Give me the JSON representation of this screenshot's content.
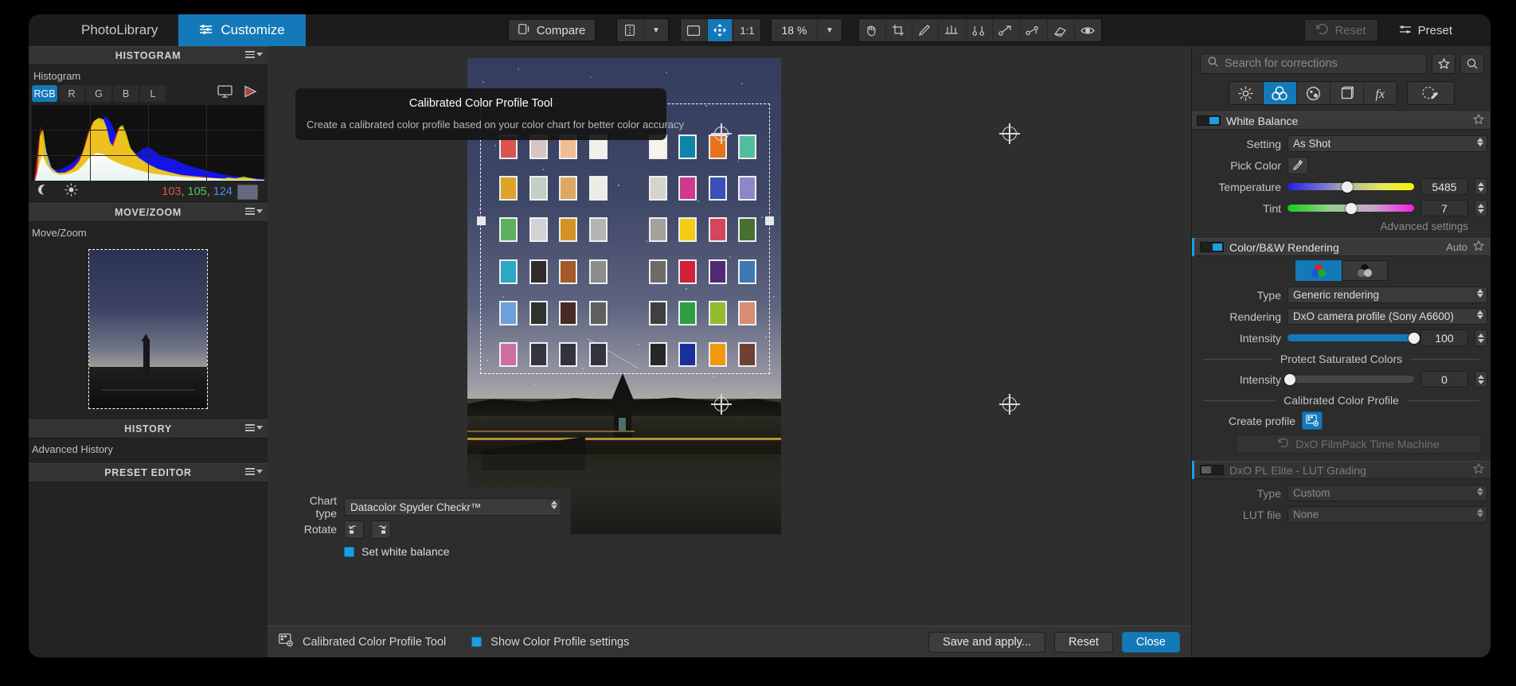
{
  "app": {
    "name": "DxO PhotoLab"
  },
  "topbar": {
    "tabs": [
      {
        "label": "PhotoLibrary",
        "icon": "library-icon",
        "active": false
      },
      {
        "label": "Customize",
        "icon": "sliders-icon",
        "active": true
      }
    ],
    "compare_label": "Compare",
    "compare_icon": "compare-icon",
    "view_mode_icon": "view-list-icon",
    "dropdown_caret": "▼",
    "fit_icon": "fit-screen-icon",
    "pan_icon": "pan-move-icon",
    "one_to_one": "1:1",
    "zoom_value": "18 %",
    "zoom_caret": "▼",
    "tools": [
      "hand-tool-icon",
      "crop-tool-icon",
      "retouch-tool-icon",
      "horizon-tool-icon",
      "control-line-icon",
      "control-point-icon",
      "graduated-filter-icon",
      "eraser-tool-icon",
      "red-eye-icon"
    ],
    "reset_label": "Reset",
    "reset_icon": "undo-icon",
    "preset_label": "Preset",
    "preset_icon": "sliders-icon"
  },
  "left_panel": {
    "histogram": {
      "section_title": "HISTOGRAM",
      "sub_label": "Histogram",
      "channels": [
        "RGB",
        "R",
        "G",
        "B",
        "L"
      ],
      "active_channel": "RGB",
      "monitor_icon": "monitor-icon",
      "gamut_icon": "gamut-warning-icon",
      "shadow_icon": "shadow-clip-icon",
      "highlight_icon": "highlight-clip-icon",
      "readout": {
        "r": "103",
        "g": "105",
        "b": "124",
        "separator": ","
      }
    },
    "move_zoom": {
      "section_title": "MOVE/ZOOM",
      "sub_label": "Move/Zoom"
    },
    "history": {
      "section_title": "HISTORY",
      "sub_label": "Advanced History"
    },
    "preset_editor": {
      "section_title": "PRESET EDITOR"
    }
  },
  "right_panel": {
    "search": {
      "placeholder": "Search for corrections",
      "icon": "search-icon"
    },
    "favorites_icon": "star-icon",
    "extra_icon": "search-circle-icon",
    "category_pills": [
      {
        "icon": "light-icon",
        "active": false
      },
      {
        "icon": "color-icon",
        "active": true
      },
      {
        "icon": "detail-icon",
        "active": false
      },
      {
        "icon": "geometry-icon",
        "active": false
      },
      {
        "icon": "effects-icon",
        "active": false
      }
    ],
    "local_adjust_icon": "local-adjustments-icon",
    "white_balance": {
      "title": "White Balance",
      "enabled": true,
      "star_icon": "star-outline-icon",
      "setting_label": "Setting",
      "setting_value": "As Shot",
      "pick_color_label": "Pick Color",
      "eyedropper_icon": "eyedropper-icon",
      "temperature_label": "Temperature",
      "temperature_value": "5485",
      "temperature_pct": 47,
      "tint_label": "Tint",
      "tint_value": "7",
      "tint_pct": 50,
      "advanced_label": "Advanced settings"
    },
    "color_bw": {
      "title": "Color/B&W Rendering",
      "auto_label": "Auto",
      "star_icon": "star-outline-icon",
      "mode_color_icon": "color-mode-icon",
      "mode_bw_icon": "bw-mode-icon",
      "mode_active": "color",
      "type_label": "Type",
      "type_value": "Generic rendering",
      "rendering_label": "Rendering",
      "rendering_value": "DxO camera profile (Sony A6600)",
      "intensity_label": "Intensity",
      "intensity_value": "100",
      "intensity_pct": 100,
      "protect_divider": "Protect Saturated Colors",
      "protect_intensity_label": "Intensity",
      "protect_intensity_value": "0",
      "protect_intensity_pct": 0,
      "calibrated_divider": "Calibrated Color Profile",
      "create_profile_label": "Create profile",
      "create_profile_icon": "color-chart-icon",
      "filmpack_label": "DxO FilmPack Time Machine",
      "filmpack_icon": "time-machine-icon"
    },
    "lut_grading": {
      "title": "DxO PL Elite - LUT Grading",
      "enabled": false,
      "star_icon": "star-outline-icon",
      "type_label": "Type",
      "type_value": "Custom",
      "lut_file_label": "LUT file",
      "lut_file_value": "None"
    }
  },
  "center": {
    "tooltip": {
      "title": "Calibrated Color Profile Tool",
      "body": "Create a calibrated color profile based on your color chart for better color accuracy"
    },
    "chart_panel": {
      "chart_type_label": "Chart type",
      "chart_type_value": "Datacolor Spyder Checkr™",
      "rotate_label": "Rotate",
      "rotate_ccw_icon": "rotate-left-icon",
      "rotate_cw_icon": "rotate-right-icon",
      "set_white_balance_label": "Set white balance",
      "set_white_balance_checked": true
    },
    "bottom_bar": {
      "tool_icon": "color-chart-icon",
      "tool_label": "Calibrated Color Profile Tool",
      "show_settings_label": "Show Color Profile settings",
      "show_settings_checked": true,
      "save_label": "Save and apply...",
      "reset_label": "Reset",
      "close_label": "Close"
    },
    "crop_handle_icon": "crosshair-handle-icon"
  },
  "colors": {
    "accent": "#1479b8",
    "panel": "#2c2c2c",
    "panel_dark": "#232323",
    "text": "#d9d9d9"
  },
  "color_chart": {
    "rows": 6,
    "cols": 8,
    "patches": [
      [
        "#d9544e",
        "#d8c5c1",
        "#f2bd93",
        "#f3efe9",
        null,
        "#f7f3ea",
        "#1083aa",
        "#e8711c",
        "#4fbe9e"
      ],
      [
        "#e0a329",
        "#c5cec2",
        "#dda862",
        "#ecece4",
        null,
        "#d7d4cb",
        "#cf3a8e",
        "#3c4fb6",
        "#8e86c9"
      ],
      [
        "#5fb05e",
        "#d4d2d6",
        "#d39327",
        "#b5b5b2",
        null,
        "#a5a19c",
        "#f2cc16",
        "#d5465c",
        "#4a7030"
      ],
      [
        "#2ba9c3",
        "#332b29",
        "#a35a26",
        "#8a8d8a",
        null,
        "#6d6b65",
        "#d0203a",
        "#4e2a72",
        "#3f79b4"
      ],
      [
        "#6d9fd8",
        "#2e3330",
        "#4a2a22",
        "#5c5f5b",
        null,
        "#3f3f3d",
        "#2f9d42",
        "#93bb2c",
        "#da8b73"
      ],
      [
        "#cc6f9e",
        "#34353f",
        "#32333c",
        "#343440",
        null,
        "#272727",
        "#1a2f9e",
        "#f0990d",
        "#6c4132"
      ]
    ]
  },
  "chart_data": {
    "type": "area",
    "title": "Histogram",
    "channels": [
      "RGB",
      "R",
      "G",
      "B",
      "L"
    ],
    "active_channel": "RGB",
    "xlabel": "",
    "ylabel": "",
    "readout_rgb": [
      103,
      105,
      124
    ],
    "series": [
      {
        "name": "R",
        "color": "#ff2222",
        "values": [
          4,
          52,
          92,
          44,
          16,
          12,
          11,
          12,
          14,
          16,
          19,
          24,
          36,
          58,
          78,
          84,
          80,
          62,
          44,
          58,
          70,
          60,
          40,
          26,
          20,
          17,
          15,
          14,
          13,
          12,
          11,
          10,
          10,
          9,
          9,
          8,
          8,
          7,
          7,
          6,
          6,
          5,
          5,
          4,
          4,
          4,
          3,
          3,
          3,
          2,
          2,
          2,
          2,
          2,
          2,
          2,
          2,
          2,
          3,
          4,
          3,
          2,
          2,
          1
        ]
      },
      {
        "name": "G",
        "color": "#22ff22",
        "values": [
          3,
          46,
          88,
          42,
          15,
          12,
          11,
          12,
          14,
          17,
          20,
          26,
          38,
          60,
          82,
          88,
          84,
          66,
          46,
          60,
          72,
          62,
          42,
          27,
          21,
          18,
          16,
          15,
          14,
          13,
          12,
          11,
          10,
          10,
          9,
          9,
          8,
          8,
          7,
          7,
          6,
          6,
          5,
          5,
          4,
          4,
          4,
          3,
          3,
          3,
          2,
          2,
          2,
          2,
          2,
          2,
          2,
          2,
          3,
          4,
          3,
          2,
          2,
          1
        ]
      },
      {
        "name": "B",
        "color": "#2222ff",
        "values": [
          2,
          30,
          58,
          34,
          14,
          12,
          12,
          13,
          15,
          18,
          22,
          26,
          30,
          34,
          40,
          46,
          54,
          66,
          82,
          96,
          90,
          70,
          52,
          42,
          38,
          40,
          44,
          40,
          34,
          30,
          28,
          30,
          34,
          30,
          26,
          24,
          22,
          20,
          19,
          18,
          17,
          16,
          15,
          14,
          13,
          12,
          11,
          10,
          9,
          8,
          8,
          7,
          6,
          6,
          5,
          5,
          4,
          4,
          3,
          3,
          2,
          2,
          1,
          1
        ]
      }
    ]
  }
}
